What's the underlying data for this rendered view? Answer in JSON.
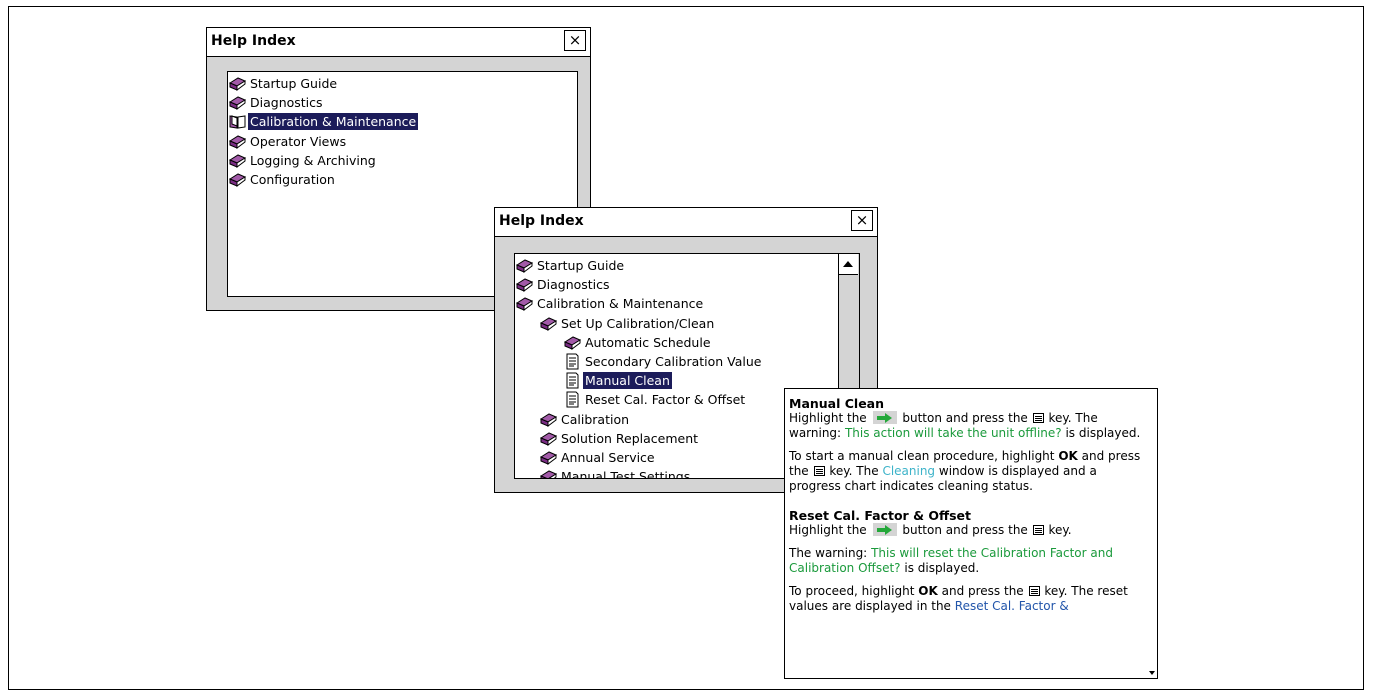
{
  "window1": {
    "title": "Help Index",
    "close_label": "×",
    "items": [
      {
        "label": "Startup Guide",
        "icon": "book-closed-icon"
      },
      {
        "label": "Diagnostics",
        "icon": "book-closed-icon"
      },
      {
        "label": "Calibration & Maintenance",
        "icon": "book-open-icon",
        "selected": true
      },
      {
        "label": "Operator Views",
        "icon": "book-closed-icon"
      },
      {
        "label": "Logging & Archiving",
        "icon": "book-closed-icon"
      },
      {
        "label": "Configuration",
        "icon": "book-closed-icon"
      }
    ]
  },
  "window2": {
    "title": "Help Index",
    "close_label": "×",
    "items": [
      {
        "label": "Startup Guide",
        "icon": "book-closed-icon",
        "level": 0
      },
      {
        "label": "Diagnostics",
        "icon": "book-closed-icon",
        "level": 0
      },
      {
        "label": "Calibration & Maintenance",
        "icon": "book-closed-icon",
        "level": 0
      },
      {
        "label": "Set Up Calibration/Clean",
        "icon": "book-closed-icon",
        "level": 1
      },
      {
        "label": "Automatic Schedule",
        "icon": "book-closed-icon",
        "level": 2
      },
      {
        "label": "Secondary Calibration Value",
        "icon": "page-icon",
        "level": 2
      },
      {
        "label": "Manual Clean",
        "icon": "page-icon",
        "level": 2,
        "selected": true
      },
      {
        "label": "Reset Cal. Factor & Offset",
        "icon": "page-icon",
        "level": 2
      },
      {
        "label": "Calibration",
        "icon": "book-closed-icon",
        "level": 1
      },
      {
        "label": "Solution Replacement",
        "icon": "book-closed-icon",
        "level": 1
      },
      {
        "label": "Annual Service",
        "icon": "book-closed-icon",
        "level": 1
      },
      {
        "label": "Manual Test Settings",
        "icon": "book-closed-icon",
        "level": 1
      }
    ]
  },
  "popup": {
    "s1_title": "Manual Clean",
    "s1_p1_a": "Highlight the",
    "s1_p1_b": "button and press the",
    "s1_p1_c": "key. The warning:",
    "s1_p1_green": "This action will take the unit offline?",
    "s1_p1_d": "is displayed.",
    "s1_p2_a": "To start a manual clean procedure, highlight",
    "s1_p2_ok": "OK",
    "s1_p2_b": "and press the",
    "s1_p2_c": "key. The",
    "s1_p2_cyan": "Cleaning",
    "s1_p2_d": "window is displayed and a progress chart indicates cleaning status.",
    "s2_title": "Reset Cal. Factor & Offset",
    "s2_p1_a": "Highlight the",
    "s2_p1_b": "button and press the",
    "s2_p1_c": "key.",
    "s2_p2_a": "The warning:",
    "s2_p2_green": "This will reset the Calibration Factor and Calibration Offset?",
    "s2_p2_b": "is displayed.",
    "s2_p3_a": "To proceed, highlight",
    "s2_p3_ok": "OK",
    "s2_p3_b": "and press the",
    "s2_p3_c": "key. The reset values are displayed in the",
    "s2_p3_blue": "Reset Cal. Factor &"
  },
  "colors": {
    "selection": "#1c1c5a",
    "warning_text": "#1b9a3c",
    "window_link": "#3db3c9",
    "link": "#2255aa"
  }
}
